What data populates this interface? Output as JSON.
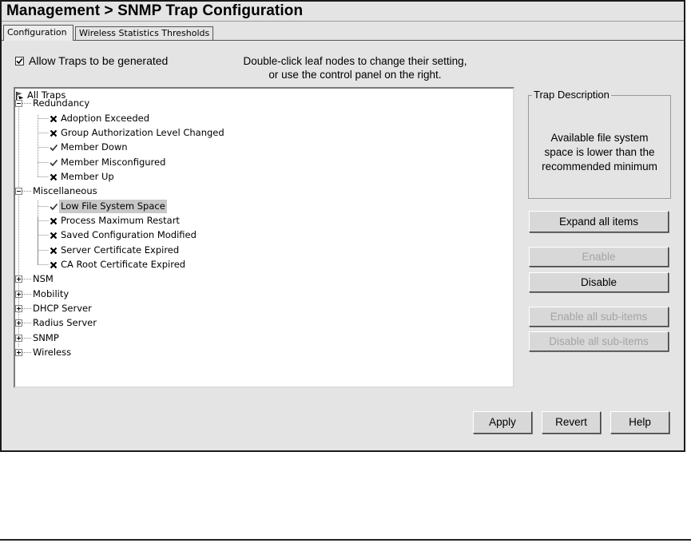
{
  "window": {
    "title": "Management > SNMP Trap Configuration"
  },
  "tabs": [
    {
      "label": "Configuration",
      "selected": true
    },
    {
      "label": "Wireless Statistics Thresholds",
      "selected": false
    }
  ],
  "allow_traps": {
    "label": "Allow Traps to be generated",
    "checked": true
  },
  "instructions": {
    "line1": "Double-click leaf nodes to change their setting,",
    "line2": "or use the control panel on the right."
  },
  "tree": {
    "root": {
      "label": "All Traps",
      "icon": "flag-icon"
    },
    "groups": [
      {
        "label": "Redundancy",
        "expanded": true,
        "items": [
          {
            "label": "Adoption Exceeded",
            "enabled": false
          },
          {
            "label": "Group Authorization Level Changed",
            "enabled": false
          },
          {
            "label": "Member Down",
            "enabled": true
          },
          {
            "label": "Member Misconfigured",
            "enabled": true
          },
          {
            "label": "Member Up",
            "enabled": false
          }
        ]
      },
      {
        "label": "Miscellaneous",
        "expanded": true,
        "items": [
          {
            "label": "Low File System Space",
            "enabled": true,
            "selected": true
          },
          {
            "label": "Process Maximum Restart",
            "enabled": false
          },
          {
            "label": "Saved Configuration Modified",
            "enabled": false
          },
          {
            "label": "Server Certificate Expired",
            "enabled": false
          },
          {
            "label": "CA Root Certificate Expired",
            "enabled": false
          }
        ]
      },
      {
        "label": "NSM",
        "expanded": false
      },
      {
        "label": "Mobility",
        "expanded": false
      },
      {
        "label": "DHCP Server",
        "expanded": false
      },
      {
        "label": "Radius Server",
        "expanded": false
      },
      {
        "label": "SNMP",
        "expanded": false
      },
      {
        "label": "Wireless",
        "expanded": false
      }
    ]
  },
  "trap_description": {
    "legend": "Trap Description",
    "text_line1": "Available file system",
    "text_line2": "space is lower than the",
    "text_line3": "recommended minimum"
  },
  "controls": {
    "expand_all": "Expand all items",
    "enable": "Enable",
    "enable_disabled": true,
    "disable": "Disable",
    "enable_all_sub": "Enable all sub-items",
    "enable_all_sub_disabled": true,
    "disable_all_sub": "Disable all sub-items",
    "disable_all_sub_disabled": true
  },
  "footer": {
    "apply": "Apply",
    "revert": "Revert",
    "help": "Help"
  },
  "colors": {
    "window_bg": "#e4e4e4",
    "tree_bg": "#ffffff",
    "selection_bg": "#c8c8c8",
    "disabled_text": "#a4a4a4"
  }
}
